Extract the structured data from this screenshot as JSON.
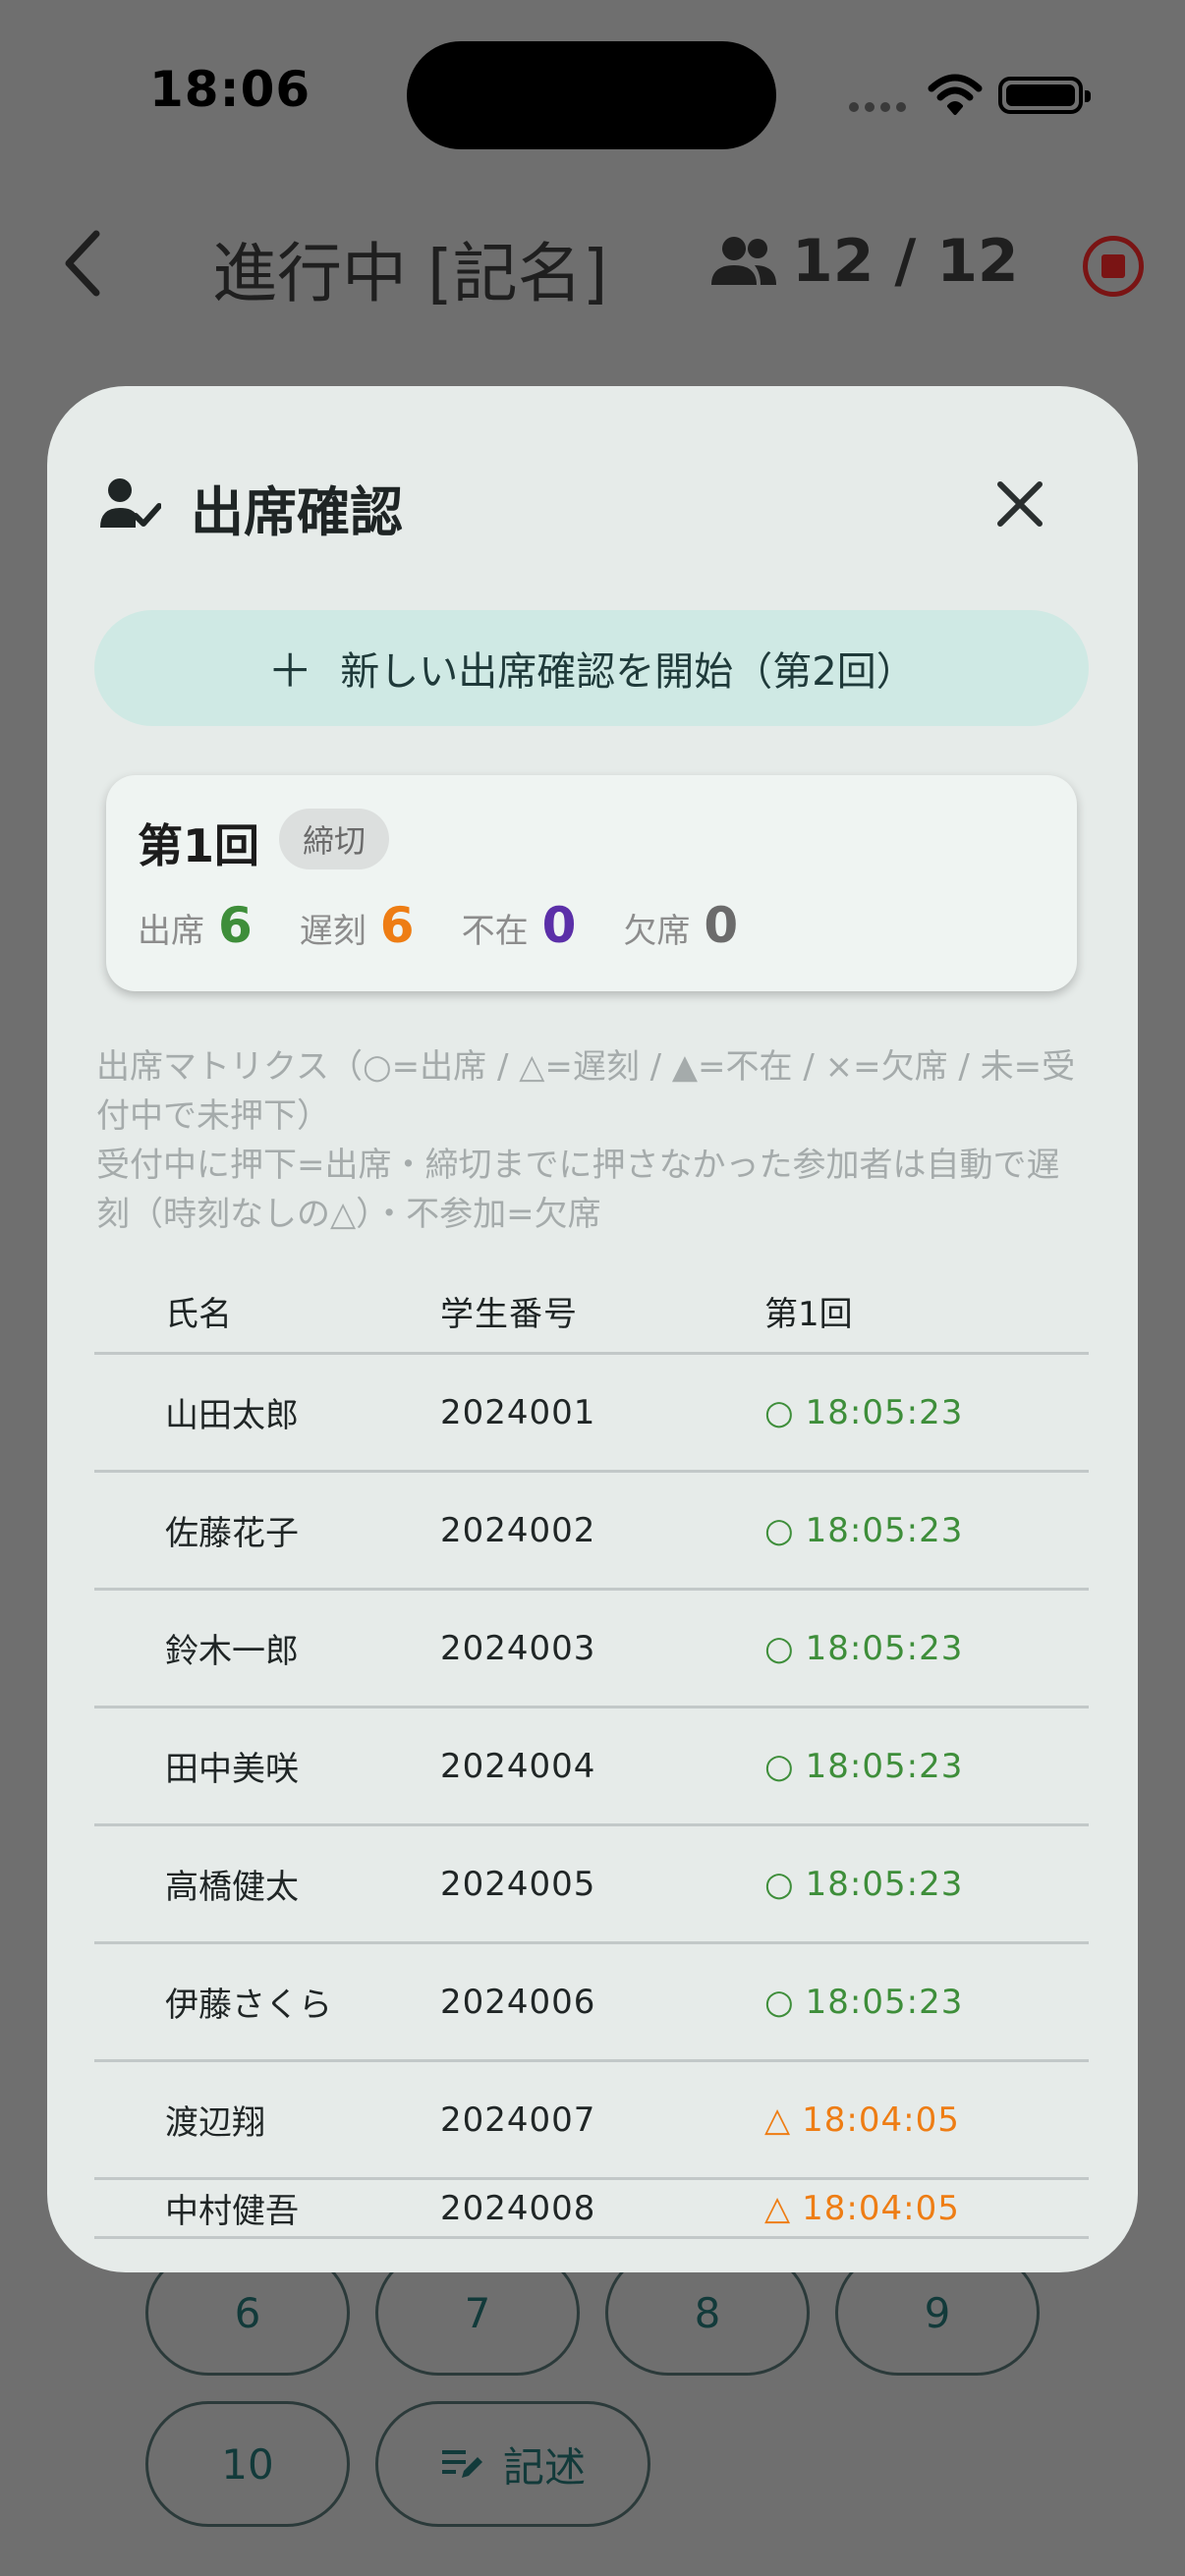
{
  "status_bar": {
    "time": "18:06"
  },
  "header": {
    "title": "進行中 [記名]",
    "count": "12 / 12"
  },
  "pad": {
    "buttons": [
      "6",
      "7",
      "8",
      "9",
      "10"
    ],
    "memo_label": "記述"
  },
  "modal": {
    "title": "出席確認",
    "start_button_label": "新しい出席確認を開始（第2回）",
    "round": {
      "title": "第1回",
      "status": "締切",
      "stats": [
        {
          "label": "出席",
          "value": "6",
          "color": "#3e8e3a"
        },
        {
          "label": "遅刻",
          "value": "6",
          "color": "#ee7d14"
        },
        {
          "label": "不在",
          "value": "0",
          "color": "#5b2fa8"
        },
        {
          "label": "欠席",
          "value": "0",
          "color": "#6b6b6b"
        }
      ]
    },
    "notes": [
      "出席マトリクス（○=出席 / △=遅刻 / ▲=不在 / ×=欠席 / 未=受付中で未押下）",
      "受付中に押下=出席・締切までに押さなかった参加者は自動で遅刻（時刻なしの△）・不参加=欠席"
    ],
    "table": {
      "headers": [
        "氏名",
        "学生番号",
        "第1回"
      ],
      "rows": [
        {
          "name": "山田太郎",
          "id": "2024001",
          "mark": "○",
          "time": "18:05:23",
          "color": "#3e8e3a"
        },
        {
          "name": "佐藤花子",
          "id": "2024002",
          "mark": "○",
          "time": "18:05:23",
          "color": "#3e8e3a"
        },
        {
          "name": "鈴木一郎",
          "id": "2024003",
          "mark": "○",
          "time": "18:05:23",
          "color": "#3e8e3a"
        },
        {
          "name": "田中美咲",
          "id": "2024004",
          "mark": "○",
          "time": "18:05:23",
          "color": "#3e8e3a"
        },
        {
          "name": "高橋健太",
          "id": "2024005",
          "mark": "○",
          "time": "18:05:23",
          "color": "#3e8e3a"
        },
        {
          "name": "伊藤さくら",
          "id": "2024006",
          "mark": "○",
          "time": "18:05:23",
          "color": "#3e8e3a"
        },
        {
          "name": "渡辺翔",
          "id": "2024007",
          "mark": "△",
          "time": "18:04:05",
          "color": "#ee7d14"
        },
        {
          "name": "中村健吾",
          "id": "2024008",
          "mark": "△",
          "time": "18:04:05",
          "color": "#ee7d14"
        }
      ]
    }
  },
  "colors": {
    "accent": "#cfe9e4",
    "stop": "#7a1414"
  }
}
